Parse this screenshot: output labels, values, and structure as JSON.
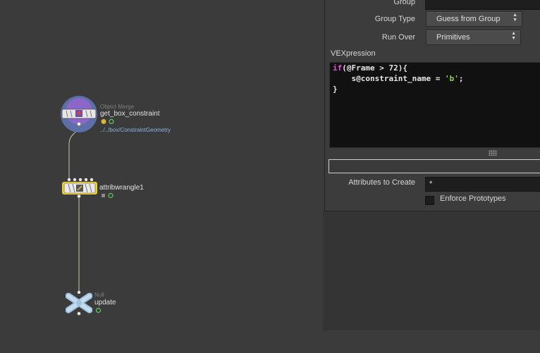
{
  "network": {
    "nodes": [
      {
        "type_label": "Object Merge",
        "name": "get_box_constraint",
        "path": "../../box/ConstraintGeometry"
      },
      {
        "name": "attribwrangle1"
      },
      {
        "type_label": "Null",
        "name": "update"
      }
    ]
  },
  "params": {
    "group_label": "Group",
    "group_value": "",
    "group_type_label": "Group Type",
    "group_type_value": "Guess from Group",
    "run_over_label": "Run Over",
    "run_over_value": "Primitives",
    "vex_label": "VEXpression",
    "vex_lines": [
      "if(@Frame > 72){",
      "    s@constraint_name = 'b';",
      "}"
    ],
    "attributes_label": "Attributes to Create",
    "attributes_value": "*",
    "enforce_label": "Enforce Prototypes"
  },
  "colors": {
    "keyword": "#e34fd2",
    "string": "#8fd14f",
    "selected_node": "#f0d230",
    "path_text": "#8db4e2"
  }
}
